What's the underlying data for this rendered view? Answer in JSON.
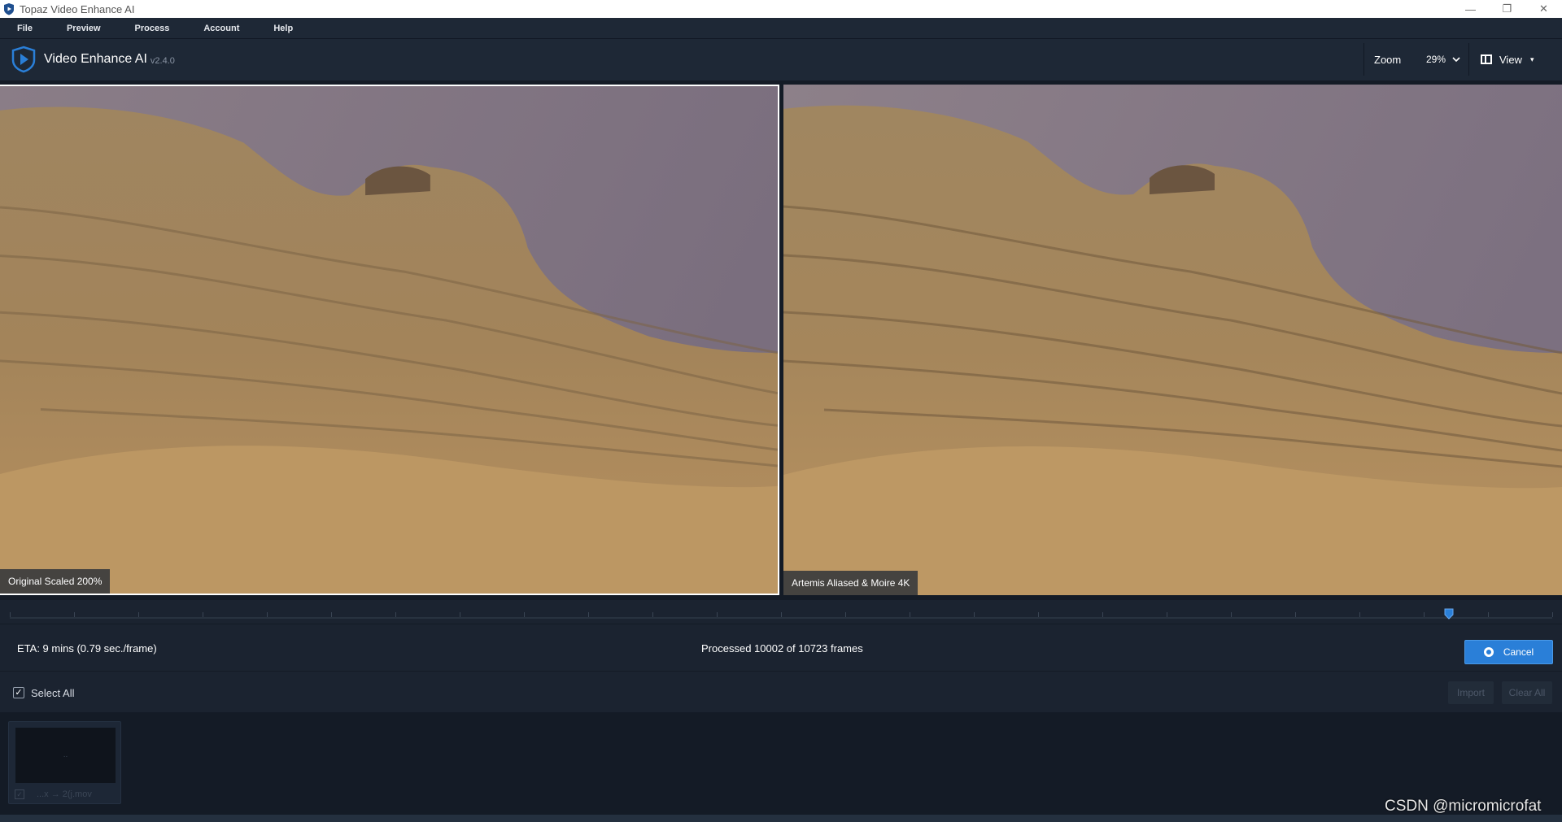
{
  "window": {
    "title": "Topaz Video Enhance AI",
    "controls": [
      "—",
      "❐",
      "✕"
    ]
  },
  "menu": [
    "File",
    "Preview",
    "Process",
    "Account",
    "Help"
  ],
  "header": {
    "app_name": "Video Enhance AI",
    "version": "v2.4.0",
    "zoom_label": "Zoom",
    "zoom_value": "29%",
    "view_label": "View"
  },
  "preview": {
    "left_label": "Original Scaled 200%",
    "right_label": "Artemis Aliased & Moire 4K"
  },
  "timeline": {
    "position": 0.933
  },
  "status": {
    "eta": "ETA:  9 mins  (0.79 sec./frame)",
    "processed": "Processed 10002 of 10723 frames",
    "cancel_label": "Cancel"
  },
  "selection": {
    "select_all_label": "Select All",
    "select_all_checked": true,
    "import_label": "Import",
    "clear_label": "Clear All"
  },
  "queue": [
    {
      "name": "...x → 2(j.mov",
      "thumb_text": "..",
      "checked": true
    }
  ],
  "watermark": "CSDN @micromicrofat",
  "colors": {
    "accent": "#2a7fd8",
    "panel": "#1e2836",
    "background": "#141b26"
  }
}
